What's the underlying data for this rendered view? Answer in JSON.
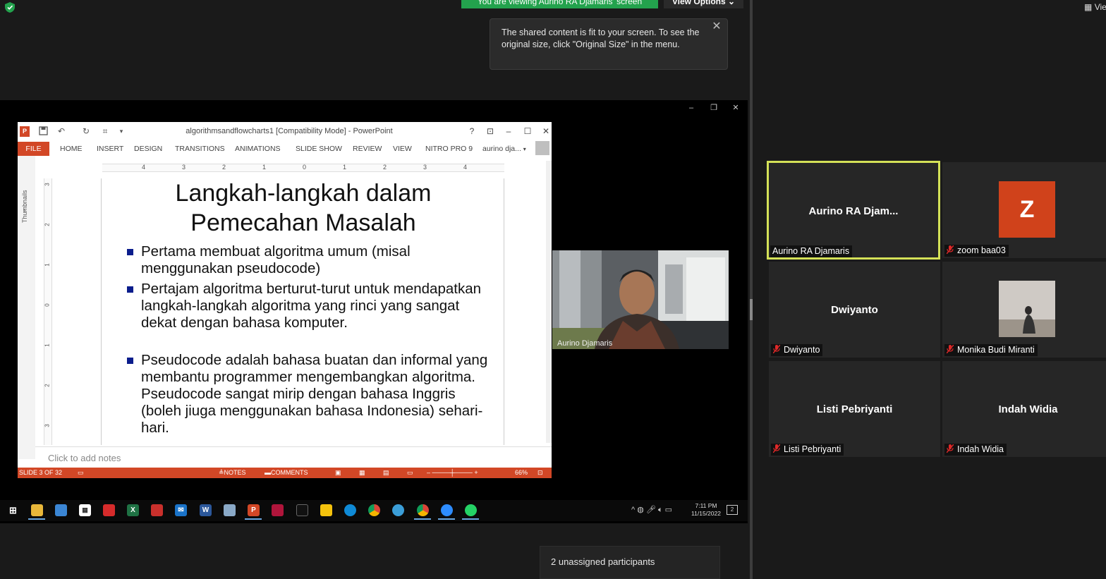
{
  "zoom_top": {
    "viewing_banner": "You are viewing Aurino RA Djamaris' screen",
    "view_options": "View Options",
    "tooltip_text": "The shared content is fit to your screen. To see the original size, click \"Original Size\" in the menu."
  },
  "powerpoint": {
    "doc_title": "algorithmsandflowcharts1 [Compatibility Mode] - PowerPoint",
    "tabs": [
      "FILE",
      "HOME",
      "INSERT",
      "DESIGN",
      "TRANSITIONS",
      "ANIMATIONS",
      "SLIDE SHOW",
      "REVIEW",
      "VIEW",
      "NITRO PRO 9"
    ],
    "user": "aurino dja...",
    "thumbnails_label": "Thumbnails",
    "ruler_h": [
      "4",
      "3",
      "2",
      "1",
      "0",
      "1",
      "2",
      "3",
      "4"
    ],
    "ruler_v": [
      "3",
      "2",
      "1",
      "0",
      "1",
      "2",
      "3"
    ],
    "slide_title_line1": "Langkah-langkah dalam",
    "slide_title_line2": "Pemecahan Masalah",
    "bullets": [
      "Pertama membuat algoritma umum (misal menggunakan pseudocode)",
      "Pertajam algoritma berturut-turut untuk mendapatkan langkah-langkah algoritma yang rinci yang sangat dekat dengan bahasa komputer.",
      "Pseudocode adalah bahasa buatan dan informal yang membantu programmer mengembangkan algoritma. Pseudocode sangat mirip dengan bahasa Inggris (boleh jiuga menggunakan bahasa Indonesia) sehari-hari."
    ],
    "notes_placeholder": "Click to add notes",
    "status_slide": "SLIDE 3 OF 32",
    "status_notes": "NOTES",
    "status_comments": "COMMENTS",
    "zoom_level": "66%"
  },
  "speaker_video": {
    "label": "Aurino Djamaris"
  },
  "taskbar": {
    "time": "7:11 PM",
    "date": "11/15/2022",
    "notif_count": "2"
  },
  "unassigned_toast": "2 unassigned participants",
  "right_panel": {
    "view_label": "Vie",
    "tiles": [
      {
        "center_name": "Aurino  RA  Djam...",
        "label": "Aurino RA Djamaris",
        "muted": false,
        "active": true
      },
      {
        "avatar_letter": "Z",
        "label": "zoom baa03",
        "muted": true
      },
      {
        "center_name": "Dwiyanto",
        "label": "Dwiyanto",
        "muted": true
      },
      {
        "label": "Monika Budi Miranti",
        "muted": true,
        "photo": true
      },
      {
        "center_name": "Listi Pebriyanti",
        "label": "Listi Pebriyanti",
        "muted": true
      },
      {
        "center_name": "Indah Widia",
        "label": "Indah Widia",
        "muted": true
      }
    ]
  },
  "colors": {
    "banner_green": "#23a24d",
    "ppt_orange": "#d24726",
    "active_speaker": "#d4e157",
    "mute_red": "#e02828",
    "avatar_z": "#d0421b"
  }
}
